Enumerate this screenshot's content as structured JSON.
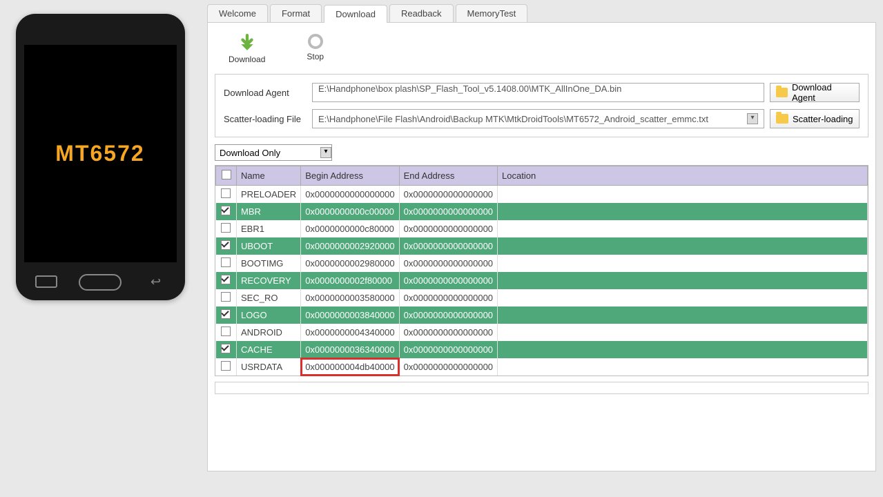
{
  "phone": {
    "chipset": "MT6572"
  },
  "tabs": [
    {
      "label": "Welcome"
    },
    {
      "label": "Format"
    },
    {
      "label": "Download"
    },
    {
      "label": "Readback"
    },
    {
      "label": "MemoryTest"
    }
  ],
  "toolbar": {
    "download_label": "Download",
    "stop_label": "Stop"
  },
  "files": {
    "agent_label": "Download Agent",
    "agent_path": "E:\\Handphone\\box plash\\SP_Flash_Tool_v5.1408.00\\MTK_AllInOne_DA.bin",
    "agent_btn": "Download Agent",
    "scatter_label": "Scatter-loading File",
    "scatter_path": "E:\\Handphone\\File Flash\\Android\\Backup MTK\\MtkDroidTools\\MT6572_Android_scatter_emmc.txt",
    "scatter_btn": "Scatter-loading"
  },
  "mode": {
    "selected": "Download Only"
  },
  "table": {
    "headers": {
      "name": "Name",
      "begin": "Begin Address",
      "end": "End Address",
      "location": "Location"
    },
    "rows": [
      {
        "name": "PRELOADER",
        "begin": "0x0000000000000000",
        "end": "0x0000000000000000",
        "loc": "",
        "tone": "white",
        "checked": false
      },
      {
        "name": "MBR",
        "begin": "0x0000000000c00000",
        "end": "0x0000000000000000",
        "loc": "",
        "tone": "green",
        "checked": true
      },
      {
        "name": "EBR1",
        "begin": "0x0000000000c80000",
        "end": "0x0000000000000000",
        "loc": "",
        "tone": "white",
        "checked": false
      },
      {
        "name": "UBOOT",
        "begin": "0x0000000002920000",
        "end": "0x0000000000000000",
        "loc": "",
        "tone": "green",
        "checked": true
      },
      {
        "name": "BOOTIMG",
        "begin": "0x0000000002980000",
        "end": "0x0000000000000000",
        "loc": "",
        "tone": "white",
        "checked": false
      },
      {
        "name": "RECOVERY",
        "begin": "0x0000000002f80000",
        "end": "0x0000000000000000",
        "loc": "",
        "tone": "green",
        "checked": true
      },
      {
        "name": "SEC_RO",
        "begin": "0x0000000003580000",
        "end": "0x0000000000000000",
        "loc": "",
        "tone": "white",
        "checked": false
      },
      {
        "name": "LOGO",
        "begin": "0x0000000003840000",
        "end": "0x0000000000000000",
        "loc": "",
        "tone": "green",
        "checked": true
      },
      {
        "name": "ANDROID",
        "begin": "0x0000000004340000",
        "end": "0x0000000000000000",
        "loc": "",
        "tone": "white",
        "checked": false
      },
      {
        "name": "CACHE",
        "begin": "0x0000000036340000",
        "end": "0x0000000000000000",
        "loc": "",
        "tone": "green",
        "checked": true
      },
      {
        "name": "USRDATA",
        "begin": "0x000000004db40000",
        "end": "0x0000000000000000",
        "loc": "",
        "tone": "white",
        "checked": false,
        "hl_begin": true
      }
    ]
  }
}
